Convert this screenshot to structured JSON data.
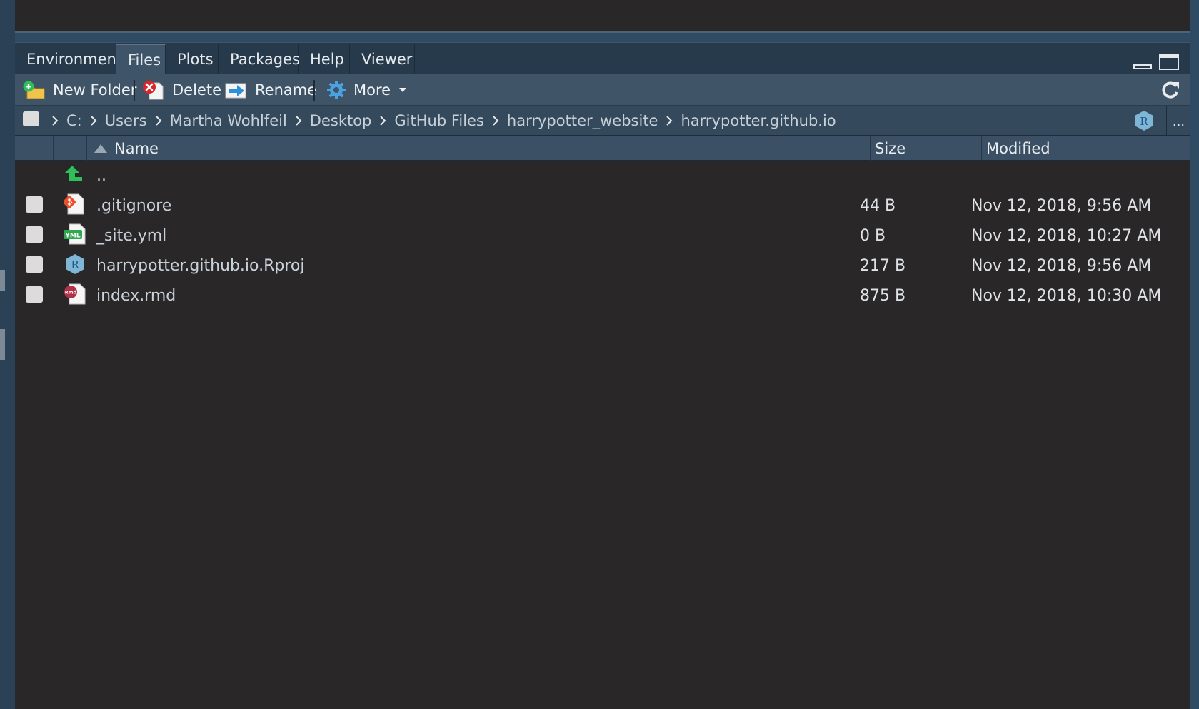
{
  "tabs": [
    {
      "label": "Environment",
      "active": false
    },
    {
      "label": "Files",
      "active": true
    },
    {
      "label": "Plots",
      "active": false
    },
    {
      "label": "Packages",
      "active": false
    },
    {
      "label": "Help",
      "active": false
    },
    {
      "label": "Viewer",
      "active": false
    }
  ],
  "toolbar": {
    "new_folder": "New Folder",
    "delete": "Delete",
    "rename": "Rename",
    "more": "More",
    "icons": {
      "new_folder": "new-folder-icon",
      "delete": "delete-icon",
      "rename": "rename-icon",
      "more": "gear-icon",
      "refresh": "refresh-icon"
    }
  },
  "breadcrumb": {
    "items": [
      "C:",
      "Users",
      "Martha Wohlfeil",
      "Desktop",
      "GitHub Files",
      "harrypotter_website",
      "harrypotter.github.io"
    ],
    "more": "..."
  },
  "columns": {
    "name": "Name",
    "size": "Size",
    "modified": "Modified"
  },
  "parent_dir": {
    "label": "..",
    "icon": "up-arrow-icon"
  },
  "files": [
    {
      "name": ".gitignore",
      "size": "44 B",
      "modified": "Nov 12, 2018, 9:56 AM",
      "icon": "git-file-icon"
    },
    {
      "name": "_site.yml",
      "size": "0 B",
      "modified": "Nov 12, 2018, 10:27 AM",
      "icon": "yml-file-icon"
    },
    {
      "name": "harrypotter.github.io.Rproj",
      "size": "217 B",
      "modified": "Nov 12, 2018, 9:56 AM",
      "icon": "rproj-file-icon"
    },
    {
      "name": "index.rmd",
      "size": "875 B",
      "modified": "Nov 12, 2018, 10:30 AM",
      "icon": "rmd-file-icon"
    }
  ],
  "colors": {
    "pane_bg": "#292727",
    "chrome_bg": "#2f4a63",
    "toolbar_bg": "#3f5466",
    "accent_green": "#2fbf5a"
  }
}
